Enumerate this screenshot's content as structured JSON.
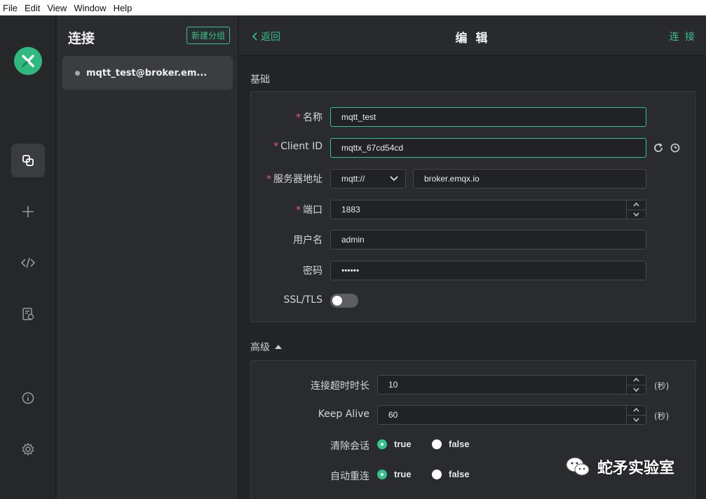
{
  "menubar": {
    "items": [
      "File",
      "Edit",
      "View",
      "Window",
      "Help"
    ]
  },
  "list_panel": {
    "title": "连接",
    "new_group_label": "新建分组",
    "connections": [
      {
        "name": "mqtt_test@broker.em..."
      }
    ]
  },
  "header": {
    "back_label": "返回",
    "title": "编 辑",
    "connect_label": "连 接"
  },
  "basic": {
    "section_label": "基础",
    "name_label": "名称",
    "name_value": "mqtt_test",
    "client_id_label": "Client ID",
    "client_id_value": "mqttx_67cd54cd",
    "host_label": "服务器地址",
    "protocol_value": "mqtt://",
    "host_value": "broker.emqx.io",
    "port_label": "端口",
    "port_value": "1883",
    "username_label": "用户名",
    "username_value": "admin",
    "password_label": "密码",
    "password_value": "••••••",
    "ssl_label": "SSL/TLS",
    "ssl_enabled": false
  },
  "advanced": {
    "section_label": "高级",
    "timeout_label": "连接超时时长",
    "timeout_value": "10",
    "timeout_unit": "(秒)",
    "keepalive_label": "Keep Alive",
    "keepalive_value": "60",
    "keepalive_unit": "(秒)",
    "clean_session_label": "清除会话",
    "reconnect_label": "自动重连",
    "true_label": "true",
    "false_label": "false"
  },
  "watermark": {
    "text": "蛇矛实验室"
  },
  "colors": {
    "accent": "#34c388",
    "required": "#f25c5c",
    "background": "#232428"
  }
}
